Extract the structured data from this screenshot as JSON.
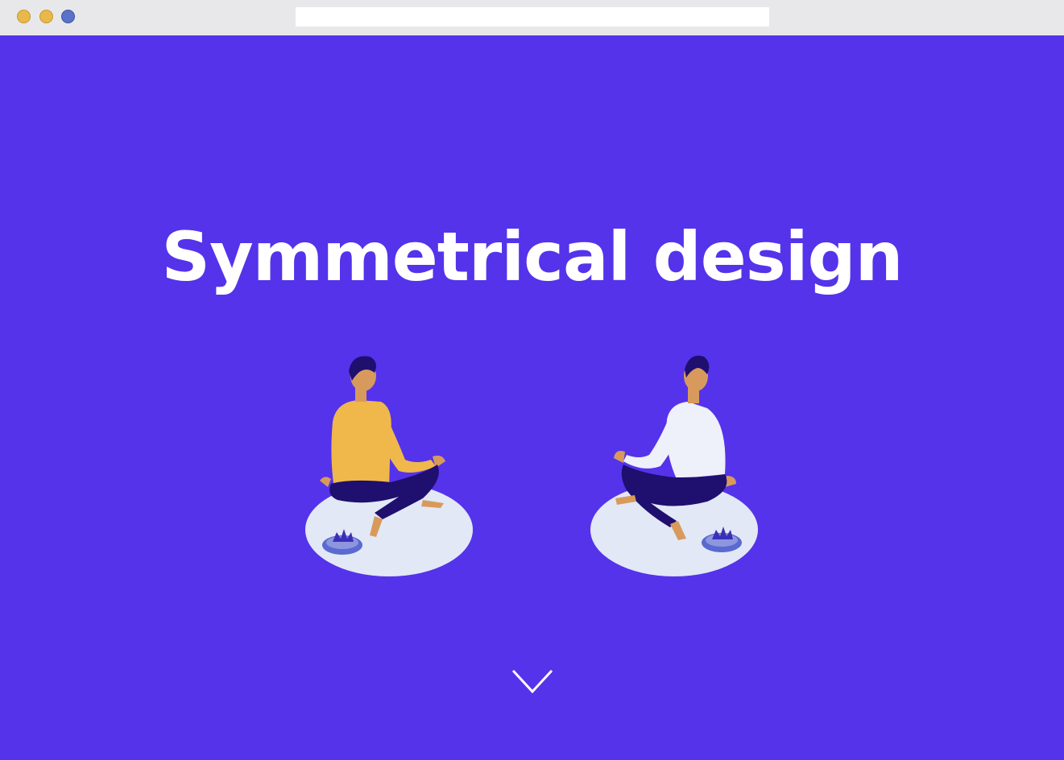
{
  "window": {
    "controls": [
      {
        "name": "close-dot",
        "color": "#e8b84b"
      },
      {
        "name": "minimize-dot",
        "color": "#e8b84b"
      },
      {
        "name": "maximize-dot",
        "color": "#5a72c8"
      }
    ],
    "address_value": ""
  },
  "hero": {
    "title": "Symmetrical design",
    "background": "#5433eb",
    "title_color": "#ffffff"
  },
  "illustrations": [
    {
      "name": "meditating-person-left",
      "shirt": "#f0b84a",
      "pants": "#1f0f6e",
      "platform": "#e2e8f6",
      "lotus": "lotus-icon"
    },
    {
      "name": "meditating-person-right",
      "shirt": "#eef0fa",
      "pants": "#1f0f6e",
      "platform": "#e2e8f6",
      "lotus": "lotus-icon"
    }
  ],
  "scroll_icon": "chevron-down-icon"
}
